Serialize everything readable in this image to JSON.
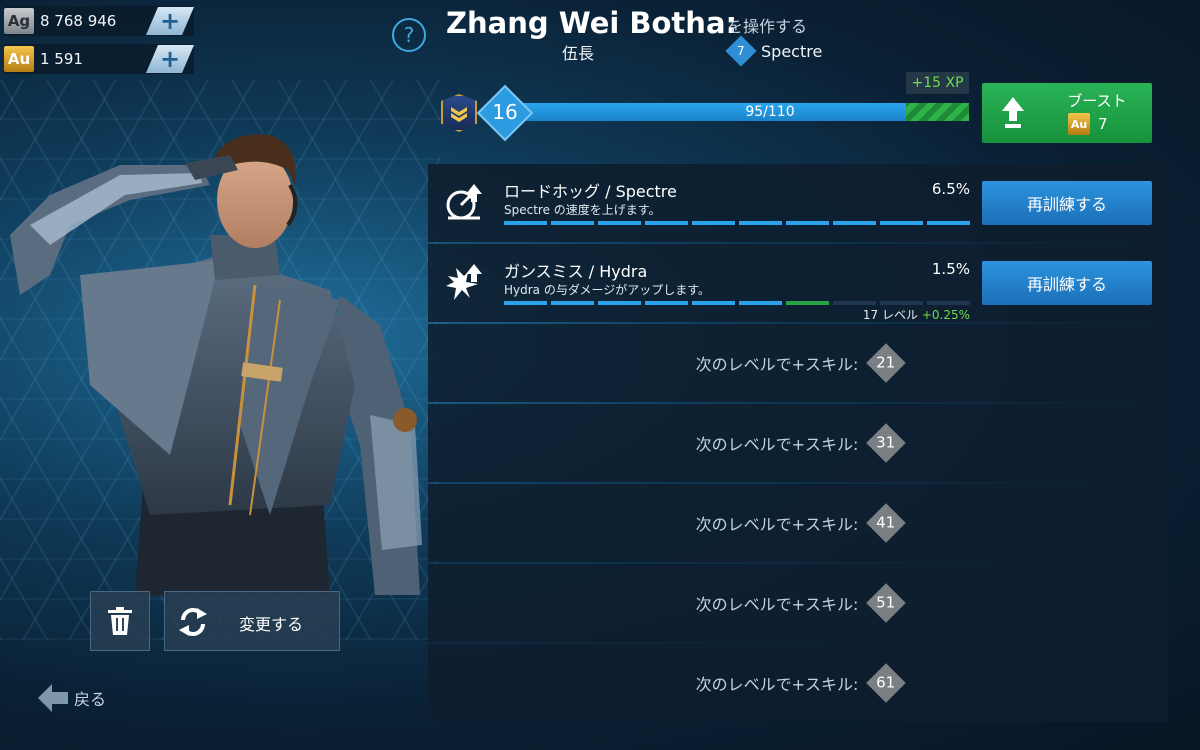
{
  "currencies": {
    "silver": {
      "symbol": "Ag",
      "amount": "8 768 946"
    },
    "gold": {
      "symbol": "Au",
      "amount": "1 591"
    },
    "add_symbol": "+"
  },
  "header": {
    "help_symbol": "?",
    "pilot_name": "Zhang Wei Botha:",
    "control_text": "を操作する",
    "rank": "伍長",
    "robot_level": "7",
    "robot_name": "Spectre"
  },
  "level": {
    "current": "16",
    "xp_text": "95/110",
    "xp_fraction": 0.864,
    "xp_gain_fraction": 0.136,
    "xp_bonus": "+15 XP"
  },
  "boost": {
    "label": "ブースト",
    "currency": "Au",
    "cost": "7"
  },
  "skills": [
    {
      "title": "ロードホッグ / Spectre",
      "description": "Spectre の速度を上げます。",
      "percent": "6.5%",
      "segments_filled": 10,
      "segments_next": 0,
      "segments_total": 10,
      "sub_level": "",
      "sub_bonus": "",
      "icon": "speed-up-icon",
      "button": "再訓練する"
    },
    {
      "title": "ガンスミス / Hydra",
      "description": "Hydra の与ダメージがアップします。",
      "percent": "1.5%",
      "segments_filled": 6,
      "segments_next": 1,
      "segments_total": 10,
      "sub_level": "17 レベル",
      "sub_bonus": "+0.25%",
      "icon": "damage-up-icon",
      "button": "再訓練する"
    }
  ],
  "locked_slots": [
    {
      "text": "次のレベルで+スキル:",
      "level": "21"
    },
    {
      "text": "次のレベルで+スキル:",
      "level": "31"
    },
    {
      "text": "次のレベルで+スキル:",
      "level": "41"
    },
    {
      "text": "次のレベルで+スキル:",
      "level": "51"
    },
    {
      "text": "次のレベルで+スキル:",
      "level": "61"
    }
  ],
  "actions": {
    "change_label": "変更する",
    "back_label": "戻る"
  },
  "colors": {
    "accent_blue": "#2d93de",
    "boost_green": "#1fa34a",
    "xp_bonus_green": "#6fdc4e",
    "gold": "#f3c64a"
  }
}
